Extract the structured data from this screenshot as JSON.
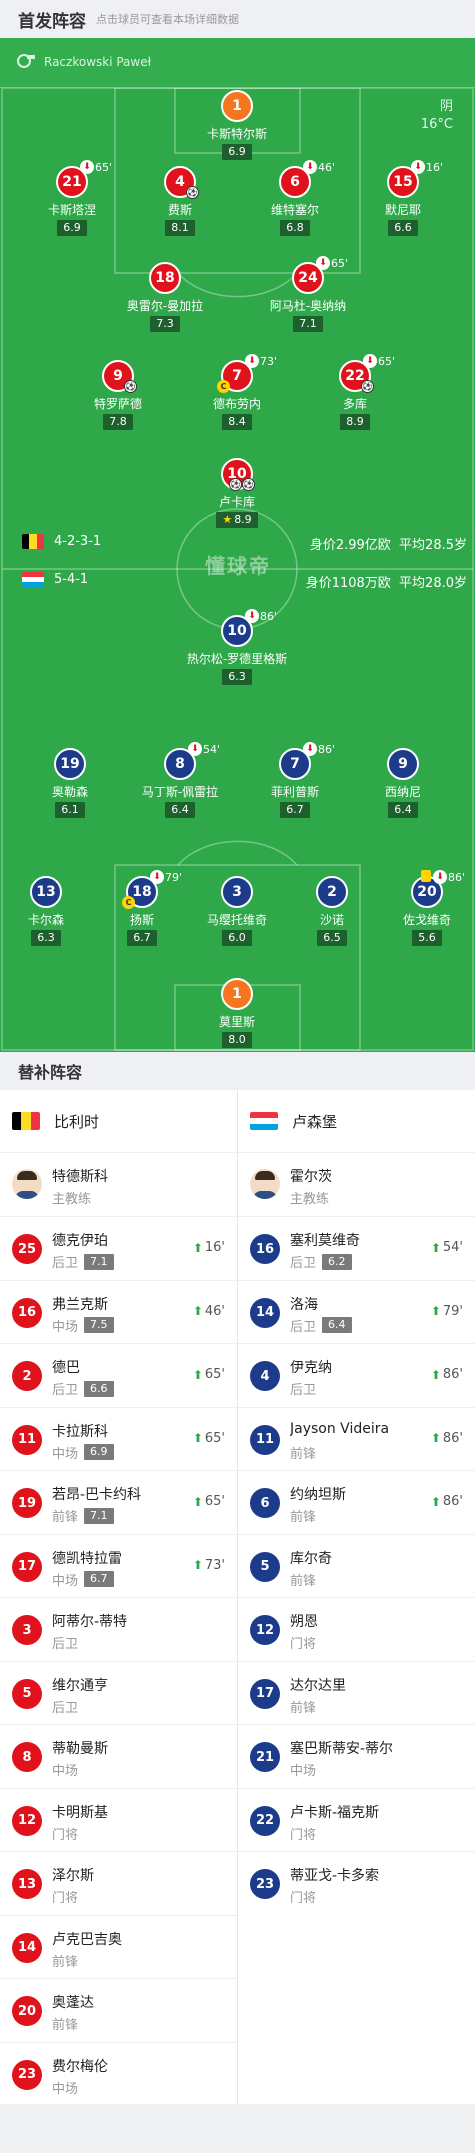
{
  "header": {
    "title": "首发阵容",
    "subtitle": "点击球员可查看本场详细数据"
  },
  "referee": {
    "name": "Raczkowski Paweł"
  },
  "weather": {
    "condition": "阴",
    "temp": "16°C"
  },
  "watermark": "懂球帝",
  "home_team": {
    "formation": "4-2-3-1",
    "value_text": "身价2.99亿欧",
    "age_text": "平均28.5岁",
    "flag_colors": [
      "#000000",
      "#fdda24",
      "#ef3340"
    ]
  },
  "away_team": {
    "formation": "5-4-1",
    "value_text": "身价1108万欧",
    "age_text": "平均28.0岁",
    "flag_colors": [
      "#ef3340",
      "#ffffff",
      "#00a2e1"
    ]
  },
  "home_players": [
    {
      "num": "1",
      "name": "卡斯特尔斯",
      "rating": "6.9",
      "gk": true
    },
    {
      "num": "21",
      "name": "卡斯塔涅",
      "rating": "6.9",
      "sub_min": "65'"
    },
    {
      "num": "4",
      "name": "费斯",
      "rating": "8.1"
    },
    {
      "num": "6",
      "name": "维特塞尔",
      "rating": "6.8",
      "sub_min": "46'"
    },
    {
      "num": "15",
      "name": "默尼耶",
      "rating": "6.6",
      "sub_min": "16'"
    },
    {
      "num": "18",
      "name": "奥雷尔-曼加拉",
      "rating": "7.3"
    },
    {
      "num": "24",
      "name": "阿马杜-奥纳纳",
      "rating": "7.1",
      "sub_min": "65'"
    },
    {
      "num": "9",
      "name": "特罗萨德",
      "rating": "7.8"
    },
    {
      "num": "7",
      "name": "德布劳内",
      "rating": "8.4",
      "sub_min": "73'"
    },
    {
      "num": "22",
      "name": "多库",
      "rating": "8.9",
      "sub_min": "65'"
    },
    {
      "num": "10",
      "name": "卢卡库",
      "rating": "8.9"
    }
  ],
  "away_players": [
    {
      "num": "10",
      "name": "热尔松-罗德里格斯",
      "rating": "6.3",
      "sub_min": "86'"
    },
    {
      "num": "19",
      "name": "奥勒森",
      "rating": "6.1"
    },
    {
      "num": "8",
      "name": "马丁斯-佩雷拉",
      "rating": "6.4",
      "sub_min": "54'"
    },
    {
      "num": "7",
      "name": "菲利普斯",
      "rating": "6.7",
      "sub_min": "86'"
    },
    {
      "num": "9",
      "name": "西纳尼",
      "rating": "6.4"
    },
    {
      "num": "13",
      "name": "卡尔森",
      "rating": "6.3"
    },
    {
      "num": "18",
      "name": "扬斯",
      "rating": "6.7",
      "sub_min": "79'"
    },
    {
      "num": "3",
      "name": "马缨托维奇",
      "rating": "6.0"
    },
    {
      "num": "2",
      "name": "沙诺",
      "rating": "6.5"
    },
    {
      "num": "20",
      "name": "佐戈维奇",
      "rating": "5.6",
      "sub_min": "86'"
    },
    {
      "num": "1",
      "name": "莫里斯",
      "rating": "8.0",
      "gk": true
    }
  ],
  "subs": {
    "title": "替补阵容",
    "home": {
      "team": "比利时",
      "coach": {
        "name": "特德斯科",
        "role": "主教练"
      },
      "players": [
        {
          "num": "25",
          "name": "德克伊珀",
          "pos": "后卫",
          "rating": "7.1",
          "min": "16'"
        },
        {
          "num": "16",
          "name": "弗兰克斯",
          "pos": "中场",
          "rating": "7.5",
          "min": "46'"
        },
        {
          "num": "2",
          "name": "德巴",
          "pos": "后卫",
          "rating": "6.6",
          "min": "65'"
        },
        {
          "num": "11",
          "name": "卡拉斯科",
          "pos": "中场",
          "rating": "6.9",
          "min": "65'"
        },
        {
          "num": "19",
          "name": "若昂-巴卡约科",
          "pos": "前锋",
          "rating": "7.1",
          "min": "65'"
        },
        {
          "num": "17",
          "name": "德凯特拉雷",
          "pos": "中场",
          "rating": "6.7",
          "min": "73'"
        },
        {
          "num": "3",
          "name": "阿蒂尔-蒂特",
          "pos": "后卫"
        },
        {
          "num": "5",
          "name": "维尔通亨",
          "pos": "后卫"
        },
        {
          "num": "8",
          "name": "蒂勒曼斯",
          "pos": "中场"
        },
        {
          "num": "12",
          "name": "卡明斯基",
          "pos": "门将"
        },
        {
          "num": "13",
          "name": "泽尔斯",
          "pos": "门将"
        },
        {
          "num": "14",
          "name": "卢克巴吉奥",
          "pos": "前锋"
        },
        {
          "num": "20",
          "name": "奥蓬达",
          "pos": "前锋"
        },
        {
          "num": "23",
          "name": "费尔梅伦",
          "pos": "中场"
        }
      ]
    },
    "away": {
      "team": "卢森堡",
      "coach": {
        "name": "霍尔茨",
        "role": "主教练"
      },
      "players": [
        {
          "num": "16",
          "name": "塞利莫维奇",
          "pos": "后卫",
          "rating": "6.2",
          "min": "54'"
        },
        {
          "num": "14",
          "name": "洛海",
          "pos": "后卫",
          "rating": "6.4",
          "min": "79'"
        },
        {
          "num": "4",
          "name": "伊克纳",
          "pos": "后卫",
          "min": "86'"
        },
        {
          "num": "11",
          "name": "Jayson Videira",
          "pos": "前锋",
          "min": "86'"
        },
        {
          "num": "6",
          "name": "约纳坦斯",
          "pos": "前锋",
          "min": "86'"
        },
        {
          "num": "5",
          "name": "库尔奇",
          "pos": "前锋"
        },
        {
          "num": "12",
          "name": "朔恩",
          "pos": "门将"
        },
        {
          "num": "17",
          "name": "达尔达里",
          "pos": "前锋"
        },
        {
          "num": "21",
          "name": "塞巴斯蒂安-蒂尔",
          "pos": "中场"
        },
        {
          "num": "22",
          "name": "卢卡斯-福克斯",
          "pos": "门将"
        },
        {
          "num": "23",
          "name": "蒂亚戈-卡多索",
          "pos": "门将"
        }
      ]
    }
  }
}
